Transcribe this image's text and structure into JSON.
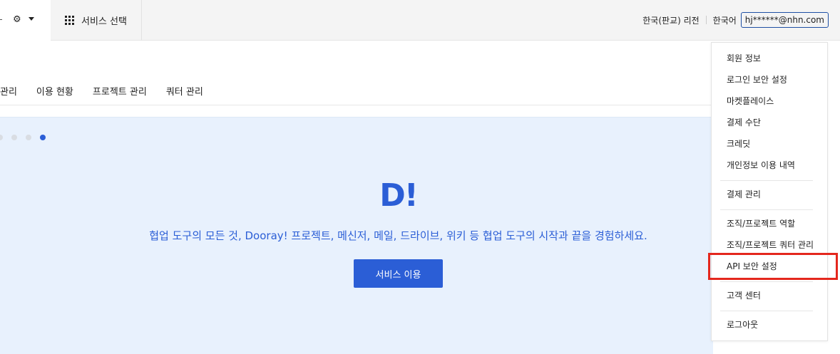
{
  "topbar": {
    "service_select_label": "서비스 선택",
    "region": "한국(판교) 리전",
    "language": "한국어",
    "account": "hj******@nhn.com"
  },
  "subnav": {
    "items": [
      "관리",
      "이용 현황",
      "프로젝트 관리",
      "쿼터 관리"
    ]
  },
  "hero": {
    "logo": "D!",
    "tagline": "협업 도구의 모든 것, Dooray! 프로젝트, 메신저, 메일, 드라이브, 위키 등 협업 도구의 시작과 끝을 경험하세요.",
    "button_label": "서비스 이용",
    "active_slide_index": 3
  },
  "account_menu": {
    "items": [
      "회원 정보",
      "로그인 보안 설정",
      "마켓플레이스",
      "결제 수단",
      "크레딧",
      "개인정보 이용 내역",
      "결제 관리",
      "조직/프로젝트 역할",
      "조직/프로젝트 쿼터 관리",
      "API 보안 설정",
      "고객 센터",
      "로그아웃"
    ],
    "highlighted_item": "API 보안 설정"
  },
  "colors": {
    "accent": "#2b5ed6",
    "hero_background": "#e8f1fd",
    "highlight": "#e4271d"
  }
}
